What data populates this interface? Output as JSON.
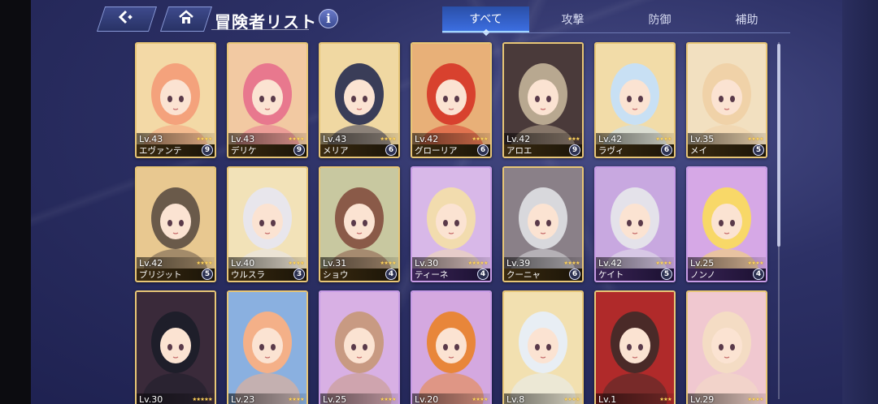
{
  "header": {
    "title": "冒険者リスト",
    "back_icon": "back-arrow-icon",
    "home_icon": "home-icon",
    "info_label": "i"
  },
  "tabs": [
    {
      "label": "すべて",
      "active": true
    },
    {
      "label": "攻撃",
      "active": false
    },
    {
      "label": "防御",
      "active": false
    },
    {
      "label": "補助",
      "active": false
    }
  ],
  "adventurers": [
    {
      "name": "エヴァンテ",
      "level": "Lv.43",
      "stars": "★★★★",
      "badge": "9",
      "frame": "gold",
      "hair": "#f4a27c",
      "bg": "#f3d9a6"
    },
    {
      "name": "デリケ",
      "level": "Lv.43",
      "stars": "★★★★",
      "badge": "9",
      "frame": "gold",
      "hair": "#e8788e",
      "bg": "#f2c9a2"
    },
    {
      "name": "メリア",
      "level": "Lv.43",
      "stars": "★★★★",
      "badge": "6",
      "frame": "gold",
      "hair": "#3a3d58",
      "bg": "#f0d8a2"
    },
    {
      "name": "グローリア",
      "level": "Lv.42",
      "stars": "★★★★",
      "badge": "6",
      "frame": "gold",
      "hair": "#d8412e",
      "bg": "#e8b078"
    },
    {
      "name": "アロエ",
      "level": "Lv.42",
      "stars": "★★★",
      "badge": "9",
      "frame": "gold",
      "hair": "#b8a890",
      "bg": "#4a3a3a"
    },
    {
      "name": "ラヴィ",
      "level": "Lv.42",
      "stars": "★★★★",
      "badge": "6",
      "frame": "gold",
      "hair": "#c8e0f4",
      "bg": "#f2dca8"
    },
    {
      "name": "メイ",
      "level": "Lv.35",
      "stars": "★★★★",
      "badge": "5",
      "frame": "gold",
      "hair": "#f0d2a8",
      "bg": "#f2e0c0"
    },
    {
      "name": "ブリジット",
      "level": "Lv.42",
      "stars": "★★★★",
      "badge": "5",
      "frame": "gold",
      "hair": "#6a5a4a",
      "bg": "#e8c890"
    },
    {
      "name": "ウルスラ",
      "level": "Lv.40",
      "stars": "★★★★",
      "badge": "3",
      "frame": "gold",
      "hair": "#e8e6ec",
      "bg": "#f2e2b8"
    },
    {
      "name": "ショウ",
      "level": "Lv.31",
      "stars": "★★★★",
      "badge": "4",
      "frame": "gold",
      "hair": "#8a5a48",
      "bg": "#c8c8a0"
    },
    {
      "name": "ティーネ",
      "level": "Lv.30",
      "stars": "★★★★★",
      "badge": "4",
      "frame": "purple",
      "hair": "#f2dcae",
      "bg": "#d8b8e8"
    },
    {
      "name": "クーニャ",
      "level": "Lv.39",
      "stars": "★★★★",
      "badge": "6",
      "frame": "gold",
      "hair": "#d8d8dc",
      "bg": "#8a8088"
    },
    {
      "name": "ケイト",
      "level": "Lv.42",
      "stars": "★★★★",
      "badge": "5",
      "frame": "purple",
      "hair": "#e4e2ea",
      "bg": "#c8a8e0"
    },
    {
      "name": "ノンノ",
      "level": "Lv.25",
      "stars": "★★★★",
      "badge": "4",
      "frame": "purple",
      "hair": "#f8d868",
      "bg": "#d6a8e6"
    },
    {
      "name": "",
      "level": "Lv.30",
      "stars": "★★★★★",
      "badge": "",
      "frame": "gold",
      "hair": "#1e1e2a",
      "bg": "#3a2a3a"
    },
    {
      "name": "",
      "level": "Lv.23",
      "stars": "★★★★",
      "badge": "",
      "frame": "gold",
      "hair": "#f4b088",
      "bg": "#8ab0e0"
    },
    {
      "name": "",
      "level": "Lv.25",
      "stars": "★★★★",
      "badge": "",
      "frame": "purple",
      "hair": "#c89a82",
      "bg": "#d8b0e4"
    },
    {
      "name": "",
      "level": "Lv.20",
      "stars": "★★★★",
      "badge": "",
      "frame": "purple",
      "hair": "#e8863a",
      "bg": "#d4a8e0"
    },
    {
      "name": "",
      "level": "Lv.8",
      "stars": "★★★★",
      "badge": "",
      "frame": "gold",
      "hair": "#e8eef4",
      "bg": "#f2e0b0"
    },
    {
      "name": "",
      "level": "Lv.1",
      "stars": "★★★",
      "badge": "",
      "frame": "gold",
      "hair": "#4a2a28",
      "bg": "#b02a2a"
    },
    {
      "name": "",
      "level": "Lv.29",
      "stars": "★★★★",
      "badge": "",
      "frame": "gold",
      "hair": "#f4dcc4",
      "bg": "#f0c8d0"
    }
  ]
}
